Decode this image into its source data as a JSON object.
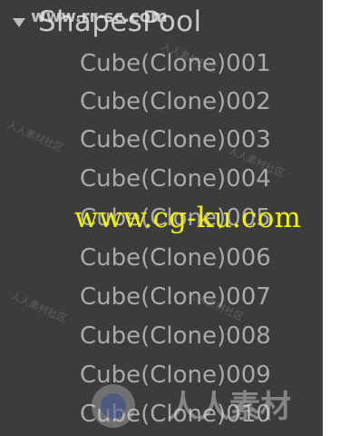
{
  "hierarchy": {
    "root_label": "ShapesPool",
    "items": [
      "Cube(Clone)001",
      "Cube(Clone)002",
      "Cube(Clone)003",
      "Cube(Clone)004",
      "Cube(Clone)005",
      "Cube(Clone)006",
      "Cube(Clone)007",
      "Cube(Clone)008",
      "Cube(Clone)009",
      "Cube(Clone)010"
    ]
  },
  "watermarks": {
    "top": "www.rr-sc.com",
    "main": "www.cg-ku.com",
    "bottom": "人人素材",
    "faint": "人人素材社区"
  },
  "colors": {
    "panel_background": "#3c3c3c",
    "root_text": "#c8c8c8",
    "item_text": "#a9a9a9",
    "watermark_yellow": "#f2f200"
  }
}
